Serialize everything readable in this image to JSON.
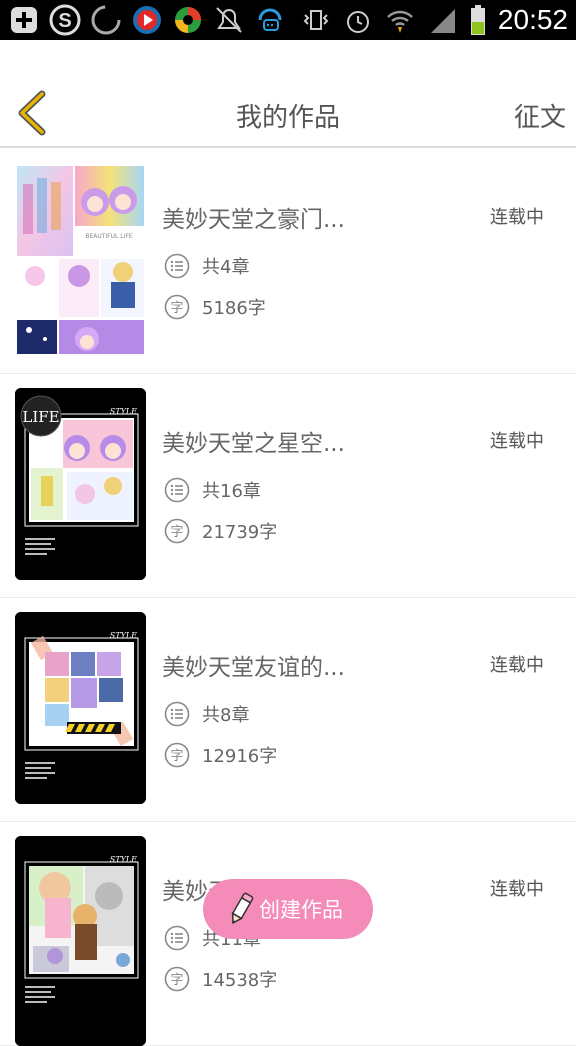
{
  "status_bar": {
    "time": "20:52",
    "icons": [
      "plus-notification-icon",
      "s-app-icon",
      "loading-circle-icon",
      "play-app-icon",
      "colorful-app-icon",
      "muted-bell-icon",
      "chat-app-icon",
      "vibrate-icon",
      "alarm-icon",
      "wifi-icon",
      "signal-icon",
      "battery-icon"
    ]
  },
  "header": {
    "title": "我的作品",
    "right_action": "征文",
    "back_icon": "chevron-left-icon",
    "accent": "#e9b400"
  },
  "works": [
    {
      "title": "美妙天堂之豪门...",
      "status": "连载中",
      "chapters": "共4章",
      "words": "5186字",
      "cover_style": "collage-light"
    },
    {
      "title": "美妙天堂之星空...",
      "status": "连载中",
      "chapters": "共16章",
      "words": "21739字",
      "cover_style": "black-style-life"
    },
    {
      "title": "美妙天堂友谊的...",
      "status": "连载中",
      "chapters": "共8章",
      "words": "12916字",
      "cover_style": "black-style"
    },
    {
      "title": "美妙天堂是光下",
      "status": "连载中",
      "chapters": "共11章",
      "words": "14538字",
      "cover_style": "black-style"
    }
  ],
  "fab": {
    "label": "创建作品",
    "color": "#f58bb8"
  },
  "cover_text": {
    "life": "LIFE",
    "style": "STYLE",
    "beautiful": "BEAUTIFUL LIFE"
  }
}
